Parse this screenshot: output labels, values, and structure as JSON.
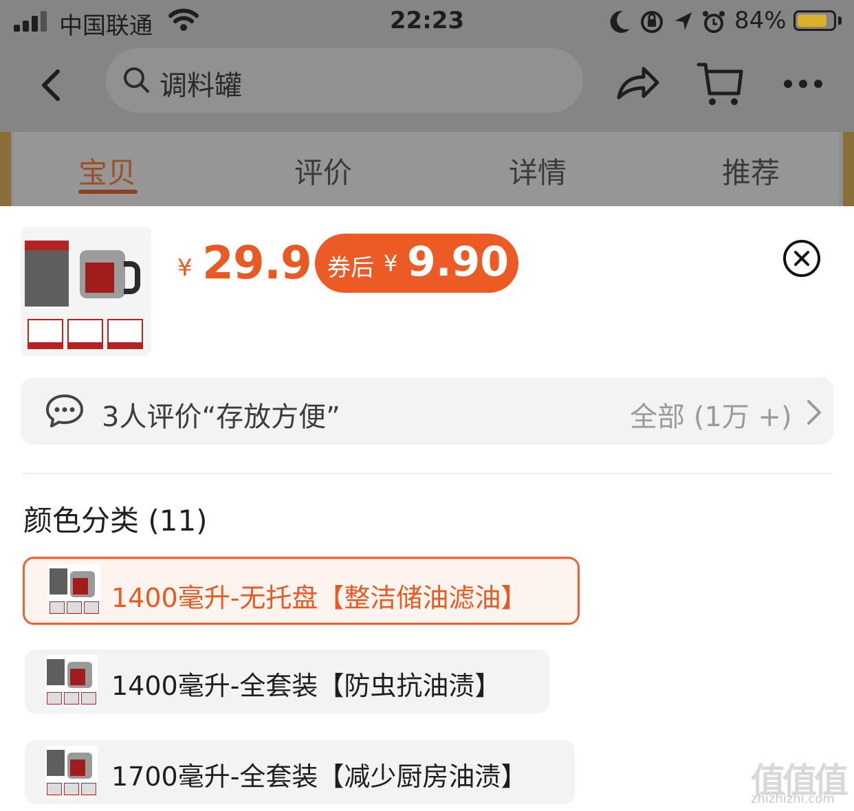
{
  "status_bar": {
    "carrier": "中国联通",
    "time": "22:23",
    "battery_percent": "84%",
    "battery_level": 0.84,
    "icons": [
      "signal-icon",
      "wifi-icon",
      "moon-icon",
      "rotation-lock-icon",
      "location-arrow-icon",
      "alarm-icon",
      "battery-icon"
    ]
  },
  "nav": {
    "search_placeholder": "调料罐",
    "icons": [
      "back-arrow-icon",
      "search-icon",
      "share-icon",
      "cart-icon",
      "more-icon"
    ]
  },
  "tabs": [
    {
      "label": "宝贝",
      "active": true
    },
    {
      "label": "评价",
      "active": false
    },
    {
      "label": "详情",
      "active": false
    },
    {
      "label": "推荐",
      "active": false
    }
  ],
  "product": {
    "currency": "¥",
    "price": "29.9",
    "coupon_label": "券后",
    "coupon_currency": "¥",
    "coupon_price": "9.90",
    "accent_color": "#E85A23"
  },
  "review": {
    "text": "3人评价“存放方便”",
    "all_label": "全部 (1万 +)"
  },
  "variants": {
    "title": "颜色分类 (11)",
    "options": [
      {
        "label": "1400毫升-无托盘【整洁储油滤油】",
        "selected": true
      },
      {
        "label": "1400毫升-全套装【防虫抗油渍】",
        "selected": false
      },
      {
        "label": "1700毫升-全套装【减少厨房油渍】",
        "selected": false
      }
    ]
  },
  "watermark": {
    "main": "值值值",
    "sub": "zhizhizhi.com"
  }
}
